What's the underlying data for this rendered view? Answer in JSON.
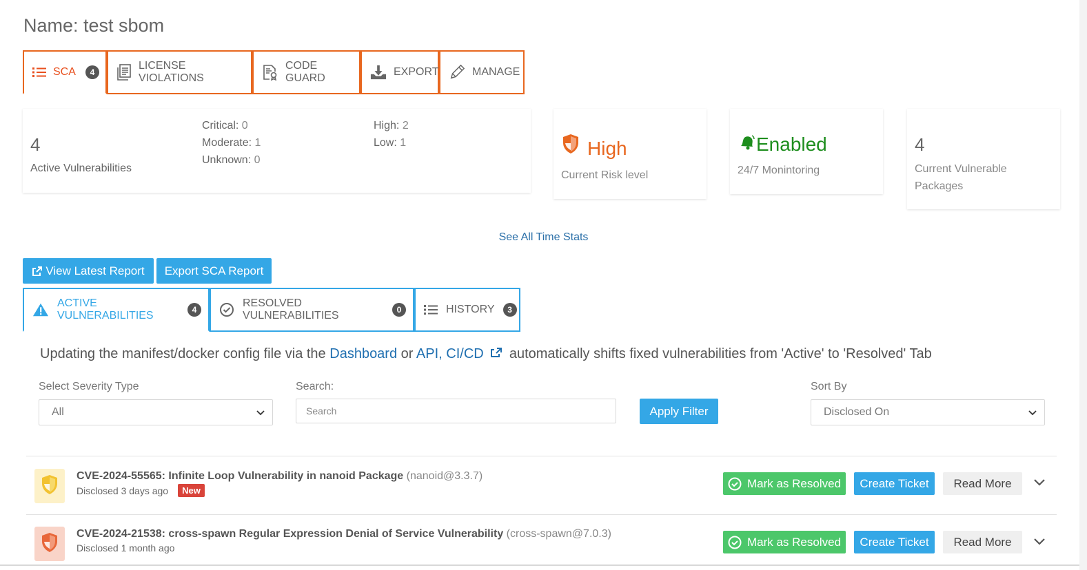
{
  "page": {
    "title": "Name: test sbom"
  },
  "top_tabs": [
    {
      "label": "SCA",
      "badge": "4",
      "icon": "list-icon"
    },
    {
      "label": "LICENSE VIOLATIONS",
      "icon": "document-icon"
    },
    {
      "label": "CODE GUARD",
      "icon": "code-guard-icon"
    },
    {
      "label": "EXPORT",
      "icon": "download-icon"
    },
    {
      "label": "MANAGE",
      "icon": "pencil-icon"
    }
  ],
  "stats": {
    "active_count": "4",
    "active_label": "Active Vulnerabilities",
    "critical_label": "Critical:",
    "critical_value": "0",
    "moderate_label": "Moderate:",
    "moderate_value": "1",
    "unknown_label": "Unknown:",
    "unknown_value": "0",
    "high_label": "High:",
    "high_value": "2",
    "low_label": "Low:",
    "low_value": "1",
    "risk_value": "High",
    "risk_label": "Current Risk level",
    "monitoring_value": "Enabled",
    "monitoring_label": "24/7 Monintoring",
    "packages_count": "4",
    "packages_label_1": "Current Vulnerable",
    "packages_label_2": "Packages"
  },
  "see_all_label": "See All Time Stats",
  "buttons": {
    "view_latest_report": "View Latest Report",
    "export_sca_report": "Export SCA Report",
    "apply_filter": "Apply Filter"
  },
  "vuln_tabs": [
    {
      "label": "ACTIVE VULNERABILITIES",
      "badge": "4"
    },
    {
      "label": "RESOLVED VULNERABILITIES",
      "badge": "0"
    },
    {
      "label": "HISTORY",
      "badge": "3"
    }
  ],
  "info": {
    "prefix": "Updating the manifest/docker config file via the",
    "dashboard_link": "Dashboard",
    "or_text": "or",
    "api_link": "API, CI/CD",
    "suffix": "automatically shifts fixed vulnerabilities from 'Active' to 'Resolved' Tab"
  },
  "filters": {
    "severity_label": "Select Severity Type",
    "severity_value": "All",
    "search_label": "Search:",
    "search_placeholder": "Search",
    "sort_label": "Sort By",
    "sort_value": "Disclosed On"
  },
  "vulnerabilities": [
    {
      "id_title": "CVE-2024-55565: Infinite Loop Vulnerability in nanoid Package",
      "package": "(nanoid@3.3.7)",
      "disclosed": "Disclosed 3 days ago",
      "new_badge": "New",
      "severity_color": "#f2c230",
      "bg_color": "#fdf1c8"
    },
    {
      "id_title": "CVE-2024-21538: cross-spawn Regular Expression Denial of Service Vulnerability",
      "package": "(cross-spawn@7.0.3)",
      "disclosed": "Disclosed 1 month ago",
      "severity_color": "#e8673a",
      "bg_color": "#f9d4c8"
    }
  ],
  "row_actions": {
    "mark_resolved": "Mark as Resolved",
    "create_ticket": "Create Ticket",
    "read_more": "Read More"
  },
  "colors": {
    "accent_orange": "#e8671f",
    "accent_blue": "#34a7e6",
    "green": "#4cc76a"
  }
}
